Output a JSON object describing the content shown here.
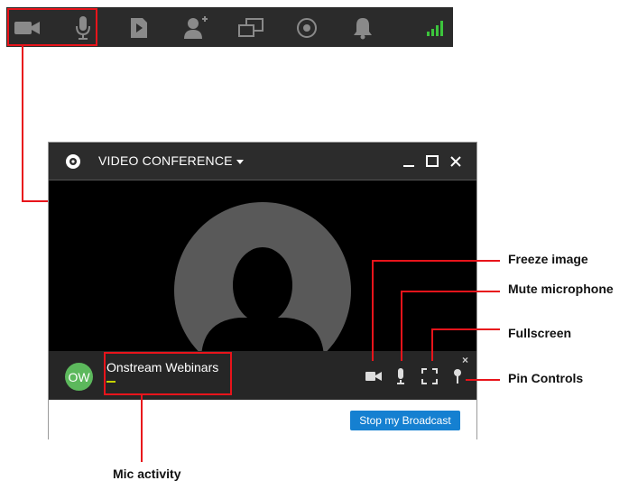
{
  "toolbar": {
    "icons": [
      "camera-icon",
      "microphone-icon",
      "play-file-icon",
      "add-user-icon",
      "screen-share-icon",
      "record-icon",
      "notification-bell-icon",
      "signal-strength-icon"
    ],
    "colors": {
      "background": "#2b2b2b",
      "icon": "#8a8a8a",
      "signal": "#3cc43c"
    }
  },
  "window": {
    "title": "VIDEO CONFERENCE",
    "controls": [
      "minimize-icon",
      "maximize-icon",
      "close-icon"
    ],
    "participant": {
      "initials": "OW",
      "name": "Onstream Webinars"
    },
    "stream_controls": [
      "camera-icon",
      "microphone-icon",
      "fullscreen-icon",
      "pin-icon"
    ],
    "close_small": "×",
    "broadcast_button": "Stop my Broadcast"
  },
  "annotations": {
    "freeze_image": "Freeze image",
    "mute_microphone": "Mute microphone",
    "fullscreen": "Fullscreen",
    "pin_controls": "Pin Controls",
    "mic_activity": "Mic activity"
  },
  "colors": {
    "accent": "#e8141b",
    "button": "#1580d1",
    "avatar": "#5cb85c"
  }
}
